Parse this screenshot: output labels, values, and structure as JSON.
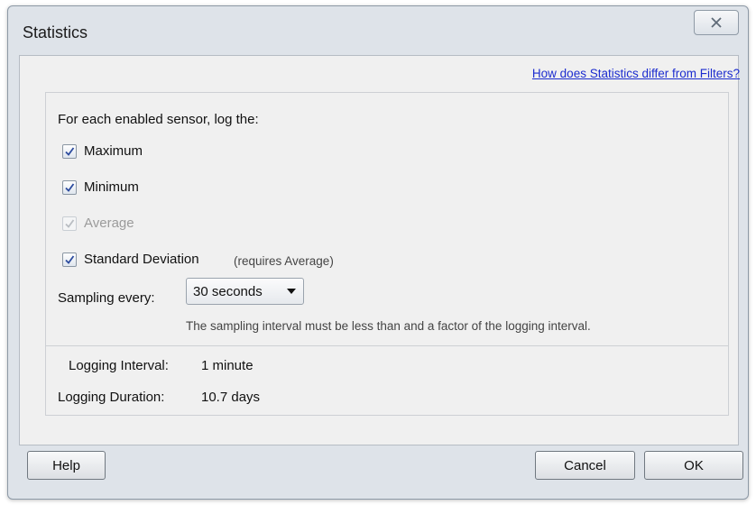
{
  "window": {
    "title": "Statistics",
    "close_icon": "close-x-icon"
  },
  "header": {
    "help_link": "How does Statistics differ from Filters?"
  },
  "stats": {
    "intro": "For each enabled sensor, log the:",
    "options": [
      {
        "label": "Maximum",
        "checked": true,
        "enabled": true,
        "note": ""
      },
      {
        "label": "Minimum",
        "checked": true,
        "enabled": true,
        "note": ""
      },
      {
        "label": "Average",
        "checked": true,
        "enabled": false,
        "note": ""
      },
      {
        "label": "Standard Deviation",
        "checked": true,
        "enabled": true,
        "note": "(requires Average)"
      }
    ],
    "sampling_label": "Sampling every:",
    "sampling_value": "30 seconds",
    "sampling_hint": "The sampling interval must be less than and a factor of the logging interval."
  },
  "logging": {
    "interval_label": "Logging Interval:",
    "interval_value": "1 minute",
    "duration_label": "Logging Duration:",
    "duration_value": "10.7 days"
  },
  "footer": {
    "help": "Help",
    "cancel": "Cancel",
    "ok": "OK"
  },
  "colors": {
    "link": "#1c2ccf",
    "checkmark": "#2c4b9e",
    "disabled_text": "#9b9b9b",
    "frame": "#dee3e9"
  }
}
